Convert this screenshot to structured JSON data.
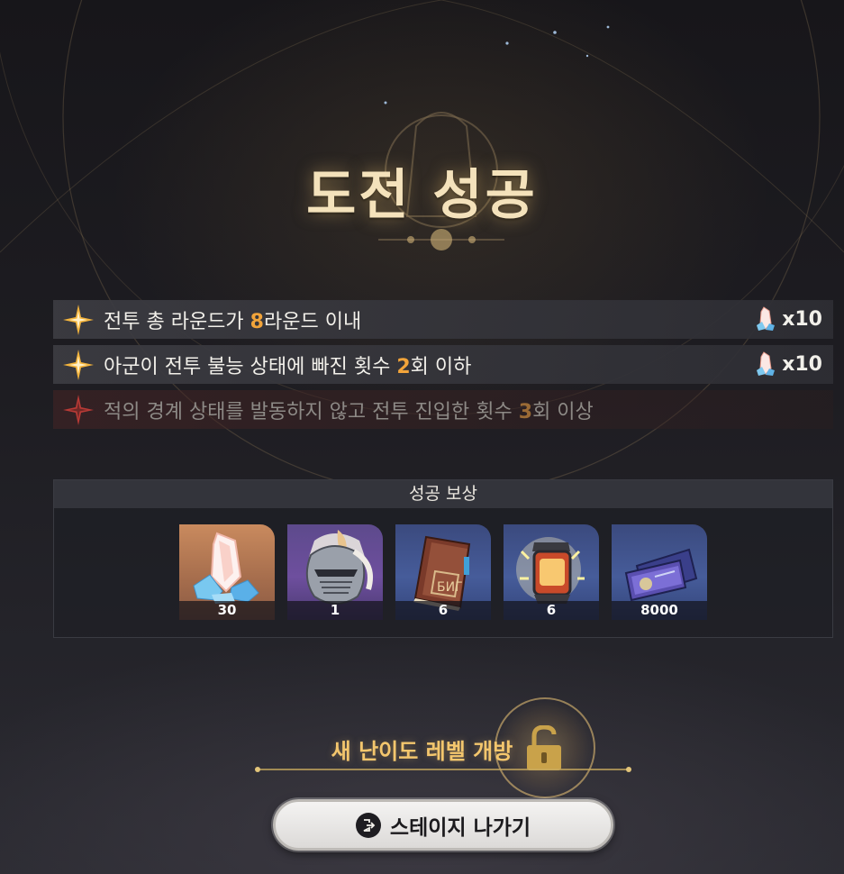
{
  "title": "도전 성공",
  "missions": [
    {
      "pre": "전투 총 라운드가 ",
      "highlight": "8",
      "post": "라운드 이내",
      "status": "completed",
      "reward_icon": "crystal-icon",
      "reward_qty": "x10"
    },
    {
      "pre": "아군이 전투 불능 상태에 빠진 횟수 ",
      "highlight": "2",
      "post": "회 이하",
      "status": "completed",
      "reward_icon": "crystal-icon",
      "reward_qty": "x10"
    },
    {
      "pre": "적의 경계 상태를 발동하지 않고 전투 진입한 횟수 ",
      "highlight": "3",
      "post": "회 이상",
      "status": "failed"
    }
  ],
  "rewards": {
    "header": "성공 보상",
    "items": [
      {
        "icon": "crystal-icon",
        "count": "30"
      },
      {
        "icon": "knight-helmet-icon",
        "count": "1"
      },
      {
        "icon": "book-icon",
        "count": "6"
      },
      {
        "icon": "lantern-canister-icon",
        "count": "6"
      },
      {
        "icon": "ticket-card-icon",
        "count": "8000"
      }
    ]
  },
  "unlock_text": "새 난이도 레벨 개방",
  "exit_button": {
    "label": "스테이지 나가기"
  },
  "colors": {
    "title": "#f4e2bb",
    "highlight": "#f2a43a",
    "unlock": "#f3c66d",
    "star_gold": "#f4b43c",
    "star_failed": "#b83a36"
  }
}
